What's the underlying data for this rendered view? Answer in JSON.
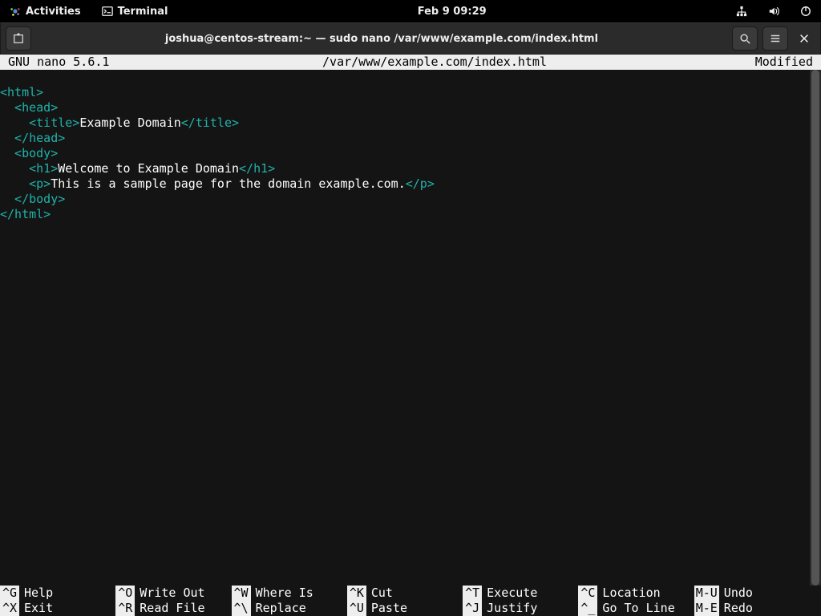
{
  "topbar": {
    "activities": "Activities",
    "app_label": "Terminal",
    "clock": "Feb 9  09:29"
  },
  "headerbar": {
    "title": "joshua@centos-stream:~ — sudo nano /var/www/example.com/index.html"
  },
  "nano": {
    "name": "  GNU nano 5.6.1",
    "file": "/var/www/example.com/index.html",
    "status": "Modified  "
  },
  "code": {
    "l1a": "<html>",
    "l2a": "  <head>",
    "l3a": "    <title>",
    "l3b": "Example Domain",
    "l3c": "</title>",
    "l4a": "  </head>",
    "l5a": "  <body>",
    "l6a": "    <h1>",
    "l6b": "Welcome to Example Domain",
    "l6c": "</h1>",
    "l7a": "    <p>",
    "l7b": "This is a sample page for the domain example.com.",
    "l7c": "</p>",
    "l8a": "  </body>",
    "l9a": "</html>"
  },
  "shortcuts": {
    "r1": [
      {
        "k": "^G",
        "l": "Help"
      },
      {
        "k": "^O",
        "l": "Write Out"
      },
      {
        "k": "^W",
        "l": "Where Is"
      },
      {
        "k": "^K",
        "l": "Cut"
      },
      {
        "k": "^T",
        "l": "Execute"
      },
      {
        "k": "^C",
        "l": "Location"
      },
      {
        "k": "M-U",
        "l": "Undo"
      }
    ],
    "r2": [
      {
        "k": "^X",
        "l": "Exit"
      },
      {
        "k": "^R",
        "l": "Read File"
      },
      {
        "k": "^\\",
        "l": "Replace"
      },
      {
        "k": "^U",
        "l": "Paste"
      },
      {
        "k": "^J",
        "l": "Justify"
      },
      {
        "k": "^_",
        "l": "Go To Line"
      },
      {
        "k": "M-E",
        "l": "Redo"
      }
    ]
  }
}
